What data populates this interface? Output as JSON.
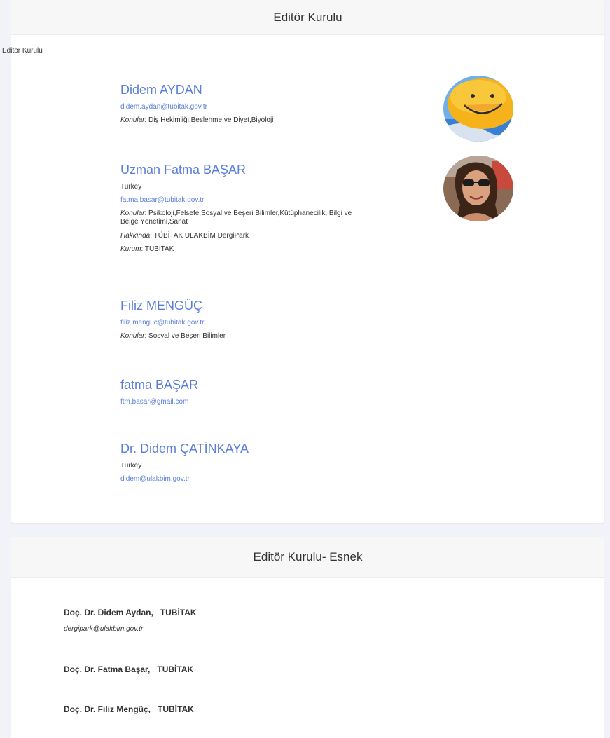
{
  "board": {
    "header": "Editör Kurulu",
    "label": "Editör Kurulu",
    "members": [
      {
        "name": "Didem AYDAN",
        "email": "didem.aydan@tubitak.gov.tr",
        "topics_label": "Konular",
        "topics": "Diş Hekimliği,Beslenme ve Diyet,Biyoloji"
      },
      {
        "name": "Uzman Fatma BAŞAR",
        "country": "Turkey",
        "email": "fatma.basar@tubitak.gov.tr",
        "topics_label": "Konular",
        "topics_line1": "Psikoloji,Felsefe,Sosyal ve Beşeri Bilimler,Kütüphanecilik, Bilgi ve",
        "topics_line2": "Belge Yönetimi,Sanat",
        "about_label": "Hakkında",
        "about": "TÜBİTAK ULAKBİM DergiPark",
        "institution_label": "Kurum",
        "institution": "TUBITAK"
      },
      {
        "name": "Filiz MENGÜÇ",
        "email": "filiz.menguc@tubitak.gov.tr",
        "topics_label": "Konular",
        "topics": "Sosyal ve Beşeri Bilimler"
      },
      {
        "name": "fatma BAŞAR",
        "email": "ftm.basar@gmail.com"
      },
      {
        "name": "Dr. Didem ÇATİNKAYA",
        "country": "Turkey",
        "email": "didem@ulakbim.gov.tr"
      }
    ]
  },
  "flex_board": {
    "header": "Editör Kurulu- Esnek",
    "items": [
      {
        "name": "Doç. Dr. Didem Aydan,   TUBİTAK",
        "email": "dergipark@ulakbim.gov.tr"
      },
      {
        "name": "Doç. Dr. Fatma Başar,   TUBİTAK"
      },
      {
        "name": "Doç. Dr. Filiz Mengüç,   TUBİTAK"
      }
    ]
  },
  "icons": {
    "avatar_1": "smiley-balloon-avatar",
    "avatar_2": "person-photo-avatar"
  },
  "colors": {
    "link": "#5b7fd8",
    "header_bg": "#f7f7f8",
    "page_bg": "#f2f3f8"
  }
}
